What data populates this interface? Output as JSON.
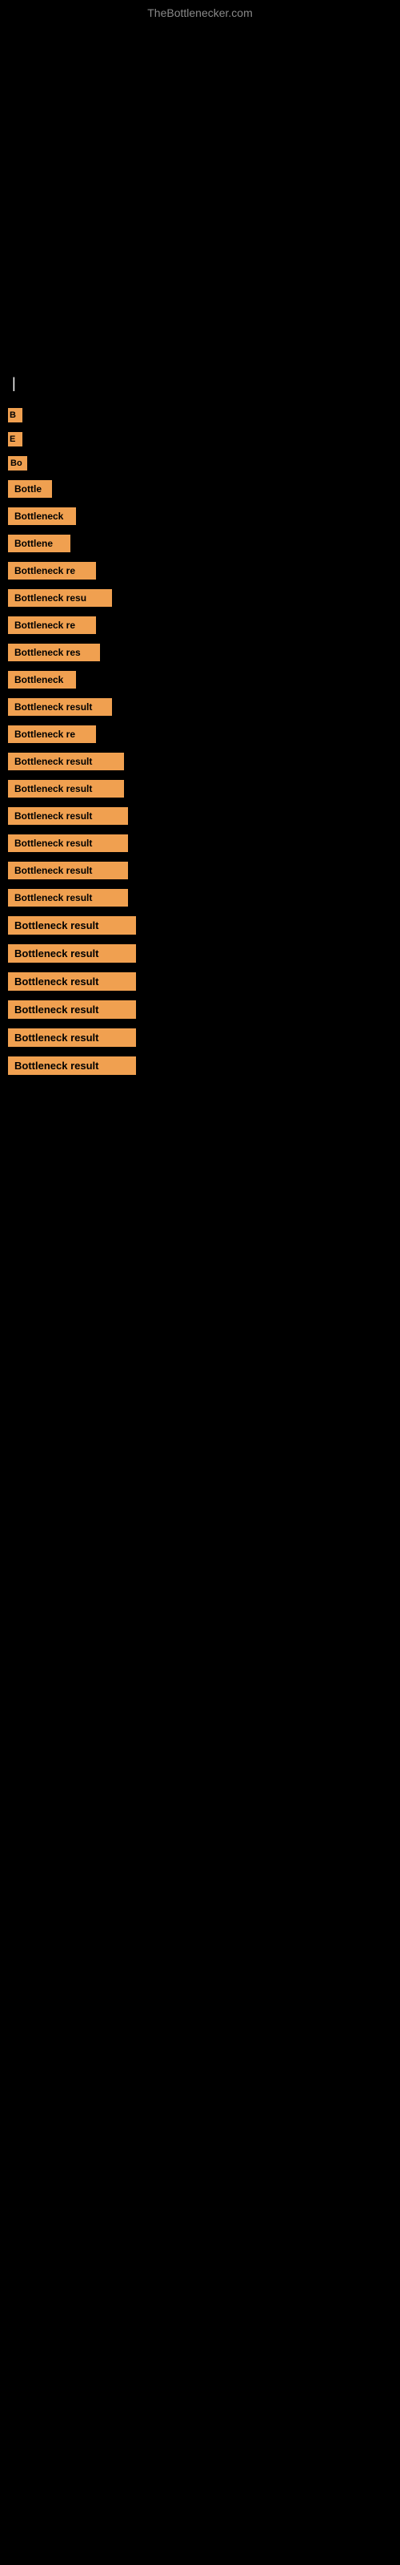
{
  "site": {
    "title": "TheBottlenecker.com"
  },
  "cursor": "|",
  "items": [
    {
      "id": 1,
      "label": "B",
      "sizeClass": "size-xs",
      "spacingClass": "item-spacing-1"
    },
    {
      "id": 2,
      "label": "E",
      "sizeClass": "size-xs",
      "spacingClass": "item-spacing-normal"
    },
    {
      "id": 3,
      "label": "Bo",
      "sizeClass": "size-sm2",
      "spacingClass": "item-spacing-normal"
    },
    {
      "id": 4,
      "label": "Bottle",
      "sizeClass": "size-md1",
      "spacingClass": "item-spacing-normal"
    },
    {
      "id": 5,
      "label": "Bottleneck",
      "sizeClass": "size-md2",
      "spacingClass": "item-spacing-normal"
    },
    {
      "id": 6,
      "label": "Bottlene",
      "sizeClass": "size-md3",
      "spacingClass": "item-spacing-normal"
    },
    {
      "id": 7,
      "label": "Bottleneck re",
      "sizeClass": "size-md4",
      "spacingClass": "item-spacing-normal"
    },
    {
      "id": 8,
      "label": "Bottleneck resu",
      "sizeClass": "size-md5",
      "spacingClass": "item-spacing-normal"
    },
    {
      "id": 9,
      "label": "Bottleneck re",
      "sizeClass": "size-md4",
      "spacingClass": "item-spacing-normal"
    },
    {
      "id": 10,
      "label": "Bottleneck res",
      "sizeClass": "size-md6",
      "spacingClass": "item-spacing-normal"
    },
    {
      "id": 11,
      "label": "Bottleneck",
      "sizeClass": "size-md2",
      "spacingClass": "item-spacing-normal"
    },
    {
      "id": 12,
      "label": "Bottleneck result",
      "sizeClass": "size-md9",
      "spacingClass": "item-spacing-normal"
    },
    {
      "id": 13,
      "label": "Bottleneck re",
      "sizeClass": "size-md4",
      "spacingClass": "item-spacing-normal"
    },
    {
      "id": 14,
      "label": "Bottleneck result",
      "sizeClass": "size-lg",
      "spacingClass": "item-spacing-normal"
    },
    {
      "id": 15,
      "label": "Bottleneck result",
      "sizeClass": "size-lg",
      "spacingClass": "item-spacing-normal"
    },
    {
      "id": 16,
      "label": "Bottleneck result",
      "sizeClass": "size-lg2",
      "spacingClass": "item-spacing-normal"
    },
    {
      "id": 17,
      "label": "Bottleneck result",
      "sizeClass": "size-lg2",
      "spacingClass": "item-spacing-normal"
    },
    {
      "id": 18,
      "label": "Bottleneck result",
      "sizeClass": "size-lg2",
      "spacingClass": "item-spacing-normal"
    },
    {
      "id": 19,
      "label": "Bottleneck result",
      "sizeClass": "size-lg2",
      "spacingClass": "item-spacing-normal"
    },
    {
      "id": 20,
      "label": "Bottleneck result",
      "sizeClass": "size-full",
      "spacingClass": "item-spacing-normal"
    },
    {
      "id": 21,
      "label": "Bottleneck result",
      "sizeClass": "size-full",
      "spacingClass": "item-spacing-normal"
    },
    {
      "id": 22,
      "label": "Bottleneck result",
      "sizeClass": "size-full",
      "spacingClass": "item-spacing-normal"
    },
    {
      "id": 23,
      "label": "Bottleneck result",
      "sizeClass": "size-full",
      "spacingClass": "item-spacing-normal"
    },
    {
      "id": 24,
      "label": "Bottleneck result",
      "sizeClass": "size-full",
      "spacingClass": "item-spacing-normal"
    },
    {
      "id": 25,
      "label": "Bottleneck result",
      "sizeClass": "size-full",
      "spacingClass": "item-spacing-normal"
    }
  ]
}
